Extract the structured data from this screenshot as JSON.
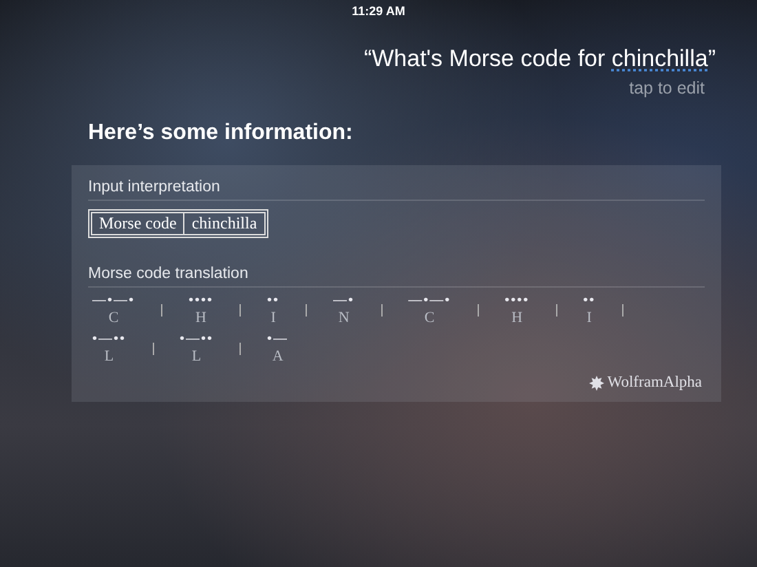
{
  "status_bar": {
    "time": "11:29 AM"
  },
  "query": {
    "before": "“What's Morse code for ",
    "underlined": "chinchilla",
    "after": "”"
  },
  "edit_hint": "tap to edit",
  "heading": "Here’s some information:",
  "card": {
    "sections": [
      {
        "kind": "input",
        "title": "Input interpretation",
        "cells": [
          "Morse code",
          "chinchilla"
        ]
      },
      {
        "kind": "morse",
        "title": "Morse code translation",
        "letters": [
          {
            "code": "—•—•",
            "letter": "C"
          },
          {
            "code": "••••",
            "letter": "H"
          },
          {
            "code": "••",
            "letter": "I"
          },
          {
            "code": "—•",
            "letter": "N"
          },
          {
            "code": "—•—•",
            "letter": "C"
          },
          {
            "code": "••••",
            "letter": "H"
          },
          {
            "code": "••",
            "letter": "I"
          },
          {
            "code": "•—••",
            "letter": "L"
          },
          {
            "code": "•—••",
            "letter": "L"
          },
          {
            "code": "•—",
            "letter": "A"
          }
        ]
      }
    ],
    "brand": "WolframAlpha"
  }
}
